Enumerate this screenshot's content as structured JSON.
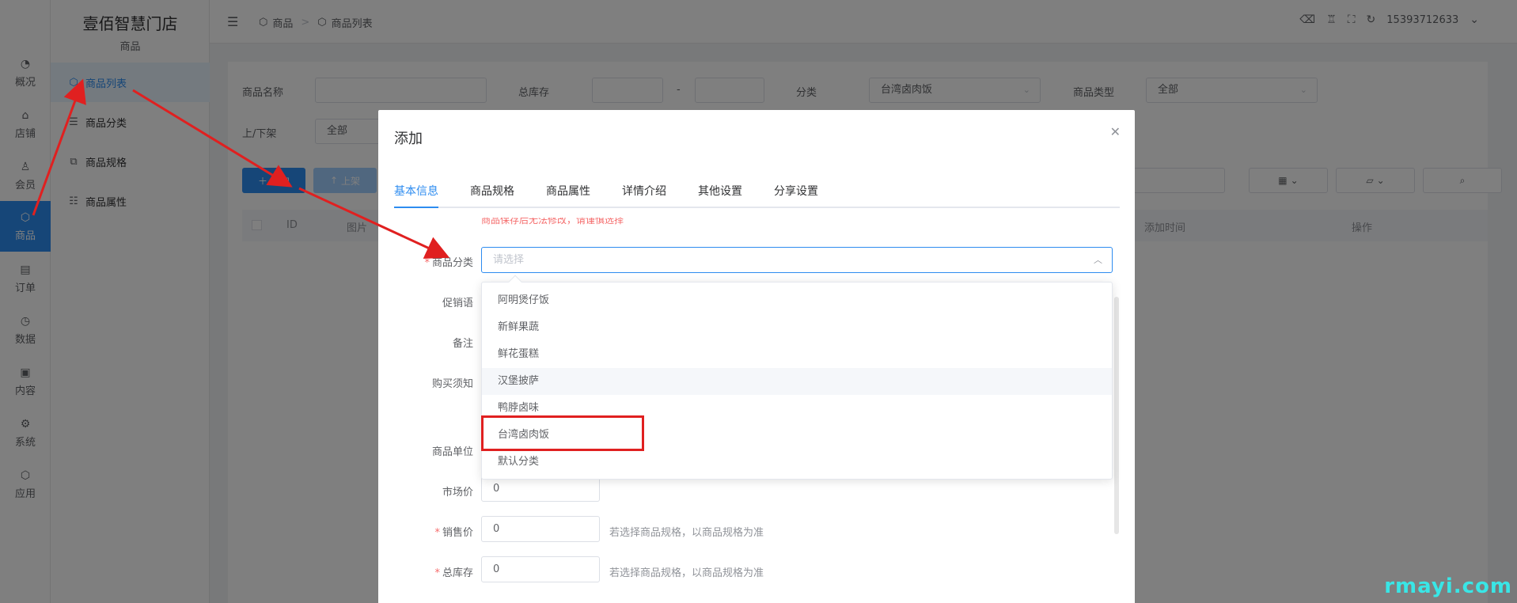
{
  "brand": {
    "title": "壹佰智慧门店",
    "subtitle": "商品"
  },
  "rail": [
    {
      "label": "概况",
      "icon": "dashboard-icon"
    },
    {
      "label": "店铺",
      "icon": "store-icon"
    },
    {
      "label": "会员",
      "icon": "user-icon"
    },
    {
      "label": "商品",
      "icon": "cube-icon"
    },
    {
      "label": "订单",
      "icon": "order-icon"
    },
    {
      "label": "数据",
      "icon": "chart-icon"
    },
    {
      "label": "内容",
      "icon": "content-icon"
    },
    {
      "label": "系统",
      "icon": "gear-icon"
    },
    {
      "label": "应用",
      "icon": "app-icon"
    }
  ],
  "sidebar": [
    {
      "label": "商品列表",
      "icon": "cube-icon"
    },
    {
      "label": "商品分类",
      "icon": "list-icon"
    },
    {
      "label": "商品规格",
      "icon": "spec-icon"
    },
    {
      "label": "商品属性",
      "icon": "sliders-icon"
    }
  ],
  "header": {
    "crumb_root": "商品",
    "crumb_sep": ">",
    "crumb_current": "商品列表",
    "user": "15393712633"
  },
  "filters": {
    "name_label": "商品名称",
    "stock_label": "总库存",
    "range_sep": "-",
    "category_label": "分类",
    "category_value": "台湾卤肉饭",
    "type_label": "商品类型",
    "type_value": "全部",
    "shelf_label": "上/下架",
    "shelf_value": "全部"
  },
  "toolbar": {
    "add_label": "添加",
    "onshelf_label": "上架"
  },
  "table": {
    "col_id": "ID",
    "col_image": "图片",
    "col_time": "添加时间",
    "col_action": "操作"
  },
  "dialog": {
    "title": "添加",
    "tabs": [
      "基本信息",
      "商品规格",
      "商品属性",
      "详情介绍",
      "其他设置",
      "分享设置"
    ],
    "warning": "商品保存后无法修改，请谨慎选择",
    "category_label": "商品分类",
    "category_placeholder": "请选择",
    "promo_label": "促销语",
    "remark_label": "备注",
    "notice_label": "购买须知",
    "unit_label": "商品单位",
    "market_price_label": "市场价",
    "market_price_value": "0",
    "sale_price_label": "销售价",
    "sale_price_value": "0",
    "sale_price_hint": "若选择商品规格，以商品规格为准",
    "stock_label": "总库存",
    "stock_value": "0",
    "stock_hint": "若选择商品规格，以商品规格为准"
  },
  "dropdown_options": [
    "阿明煲仔饭",
    "新鲜果蔬",
    "鲜花蛋糕",
    "汉堡披萨",
    "鸭脖卤味",
    "台湾卤肉饭",
    "默认分类"
  ],
  "watermark": "rmayi.com",
  "colors": {
    "primary": "#2d8cf0",
    "annotation": "#e02020",
    "watermark": "#39e6e6"
  }
}
